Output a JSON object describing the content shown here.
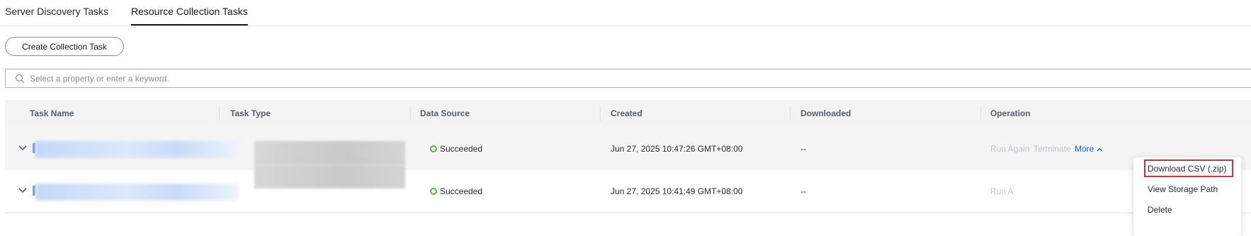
{
  "tabs": [
    {
      "label": "Server Discovery Tasks",
      "active": false
    },
    {
      "label": "Resource Collection Tasks",
      "active": true
    }
  ],
  "toolbar": {
    "create_label": "Create Collection Task"
  },
  "search": {
    "placeholder": "Select a property or enter a keyword.",
    "value": ""
  },
  "table": {
    "columns": [
      "Task Name",
      "Task Type",
      "Data Source",
      "Created",
      "Downloaded",
      "Operation"
    ],
    "rows": [
      {
        "task_name": "",
        "task_type": "",
        "data_source": "Succeeded",
        "created": "Jun 27, 2025 10:47:26 GMT+08:00",
        "downloaded": "--",
        "ops": {
          "run_again": "Run Again",
          "terminate": "Terminate",
          "more": "More"
        },
        "expanded_menu": true
      },
      {
        "task_name": "",
        "task_type": "",
        "data_source": "Succeeded",
        "created": "Jun 27, 2025 10:41:49 GMT+08:00",
        "downloaded": "--",
        "ops": {
          "run_again_partial": "Run A"
        },
        "expanded_menu": false
      }
    ]
  },
  "more_menu": {
    "items": [
      "Download CSV (.zip)",
      "View Storage Path",
      "Delete"
    ],
    "highlighted_index": 0
  },
  "colors": {
    "status_success": "#5fb346",
    "link": "#0d64d8",
    "disabled": "#c2c4c8",
    "highlight_border": "#d3313d"
  }
}
